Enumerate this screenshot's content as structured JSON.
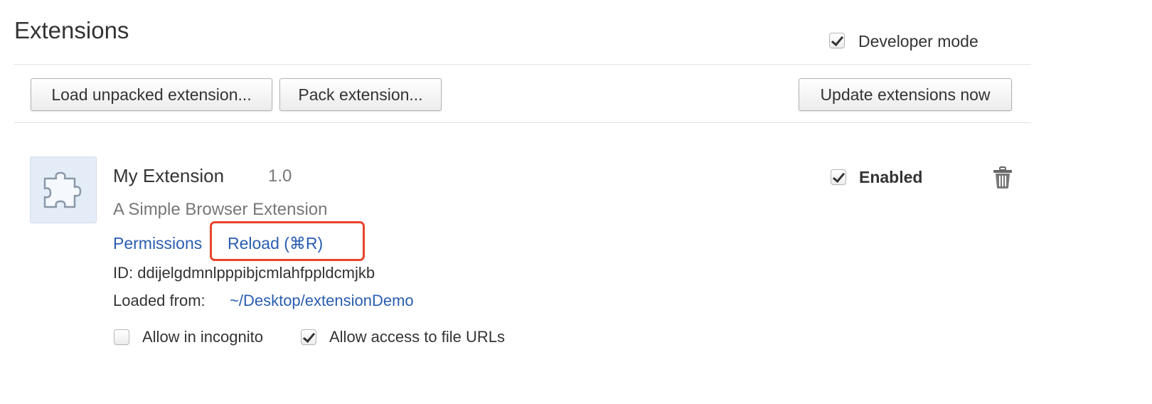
{
  "header": {
    "title": "Extensions",
    "developer_mode_label": "Developer mode",
    "developer_mode_checked": true
  },
  "toolbar": {
    "load_unpacked_label": "Load unpacked extension...",
    "pack_extension_label": "Pack extension...",
    "update_now_label": "Update extensions now"
  },
  "extension": {
    "icon": "puzzle-piece-icon",
    "name": "My Extension",
    "version": "1.0",
    "description": "A Simple Browser Extension",
    "permissions_label": "Permissions",
    "reload_label": "Reload (⌘R)",
    "id_text": "ID: ddijelgdmnlpppibjcmlahfppldcmjkb",
    "loaded_from_label": "Loaded from:",
    "loaded_from_path": "~/Desktop/extensionDemo",
    "enabled_label": "Enabled",
    "enabled_checked": true,
    "allow_incognito_label": "Allow in incognito",
    "allow_incognito_checked": false,
    "allow_file_urls_label": "Allow access to file URLs",
    "allow_file_urls_checked": true,
    "delete_icon": "trash-icon"
  },
  "colors": {
    "link": "#2a5db0",
    "highlight": "#e8452c",
    "icon_background": "#e4ecf7"
  }
}
